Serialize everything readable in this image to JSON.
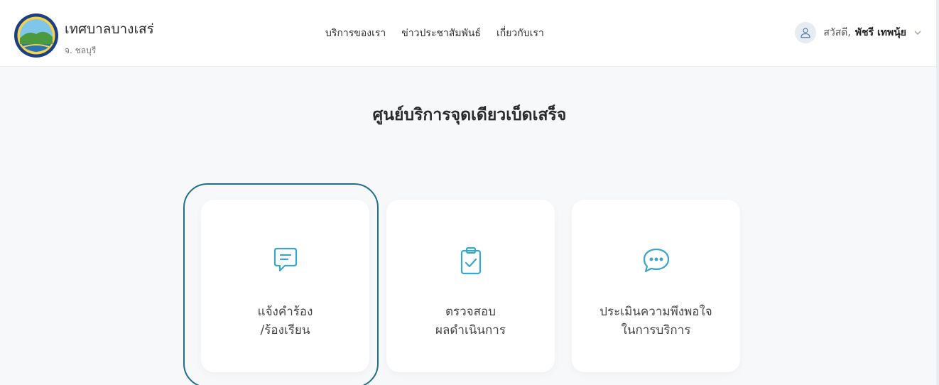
{
  "header": {
    "brand_title": "เทศบาลบางเสร่",
    "brand_subtitle": "จ. ชลบุรี",
    "nav": [
      {
        "label": "บริการของเรา"
      },
      {
        "label": "ข่าวประชาสัมพันธ์"
      },
      {
        "label": "เกี่ยวกับเรา"
      }
    ],
    "user": {
      "greeting": "สวัสดี,",
      "name": "พัชรี เทพนุ้ย"
    }
  },
  "main": {
    "title": "ศูนย์บริการจุดเดียวเบ็ดเสร็จ",
    "cards": [
      {
        "line1": "แจ้งคำร้อง",
        "line2": "/ร้องเรียน",
        "icon": "message-square-icon"
      },
      {
        "line1": "ตรวจสอบ",
        "line2": "ผลดำเนินการ",
        "icon": "clipboard-check-icon"
      },
      {
        "line1": "ประเมินความพึงพอใจ",
        "line2": "ในการบริการ",
        "icon": "chat-bubble-dots-icon"
      }
    ]
  },
  "colors": {
    "accent": "#3aa6c9",
    "highlight": "#1f6f8b",
    "background": "#f7f8fa"
  }
}
